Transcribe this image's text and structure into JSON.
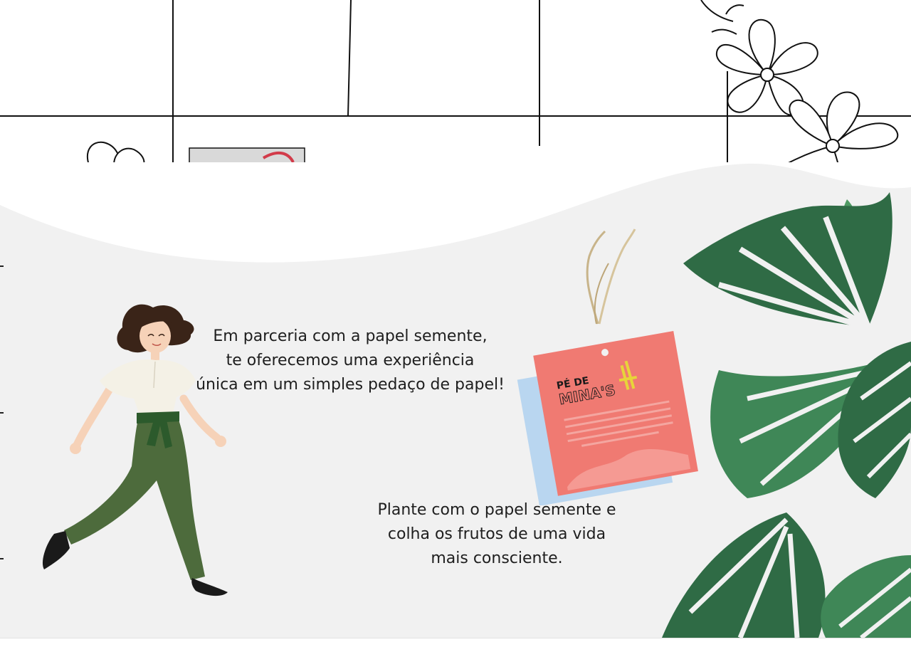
{
  "content": {
    "caption_top": {
      "lines": [
        "Em parceria com a papel semente,",
        "te oferecemos uma experiência",
        "única em um simples pedaço de papel!"
      ]
    },
    "caption_bottom": {
      "lines": [
        "Plante com o papel semente e",
        "colha os frutos de uma vida",
        "mais consciente."
      ]
    }
  },
  "seed_tag": {
    "brand_line1": "PÉ DE",
    "brand_line2": "MINA'S",
    "colors": {
      "tag": "#f07a72",
      "backing": "#b9d6f0"
    }
  },
  "colors": {
    "panel_background": "#f1f1f1",
    "text": "#1e1e1e",
    "leaf_dark": "#2f6b45",
    "leaf_light": "#4f9a63",
    "pants_green": "#4d6b3c",
    "belt_green": "#2c5a2c"
  }
}
